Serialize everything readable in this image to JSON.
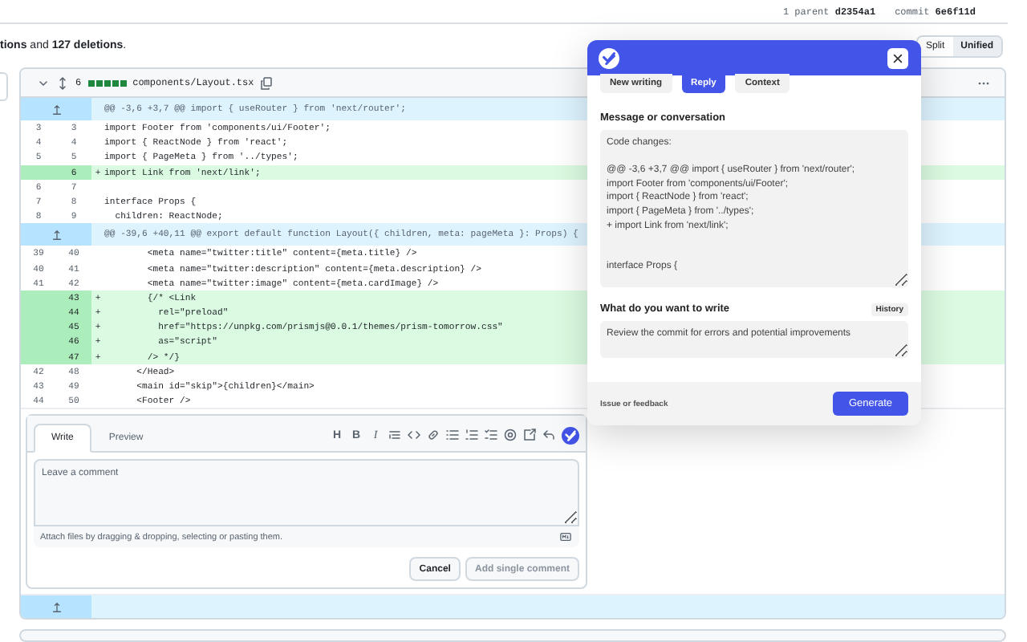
{
  "commit_info": {
    "parent": "1 parent **d2354a1**",
    "commit": "commit **6e6f11d**"
  },
  "summary": "**tions** and **127 deletions**.",
  "view_toggle": [
    {
      "label": "Split",
      "selected": false
    },
    {
      "label": "Unified",
      "selected": true
    }
  ],
  "file": {
    "changes": "6",
    "diffstat": [
      {
        "kind": "add"
      },
      {
        "kind": "add"
      },
      {
        "kind": "add"
      },
      {
        "kind": "add"
      },
      {
        "kind": "add"
      }
    ],
    "name": "components/Layout.tsx",
    "lines": [
      {
        "kind": "hunk",
        "code": "@@ -3,6 +3,7 @@ import { useRouter } from 'next/router';"
      },
      {
        "kind": "context",
        "old": "3",
        "new": "3",
        "code": "import Footer from 'components/ui/Footer';"
      },
      {
        "kind": "context",
        "old": "4",
        "new": "4",
        "code": "import { ReactNode } from 'react';"
      },
      {
        "kind": "context",
        "old": "5",
        "new": "5",
        "code": "import { PageMeta } from '../types';"
      },
      {
        "kind": "add",
        "new": "6",
        "sign": "+",
        "code": "import Link from 'next/link';"
      },
      {
        "kind": "context",
        "old": "6",
        "new": "7"
      },
      {
        "kind": "context",
        "old": "7",
        "new": "8",
        "code": "interface Props {"
      },
      {
        "kind": "context",
        "old": "8",
        "new": "9",
        "code": "  children: ReactNode;"
      },
      {
        "kind": "hunk",
        "code": "@@ -39,6 +40,11 @@ export default function Layout({ children, meta: pageMeta }: Props) {"
      },
      {
        "kind": "context",
        "old": "39",
        "new": "40",
        "code": "        <meta name=\"twitter:title\" content={meta.title} />"
      },
      {
        "kind": "context",
        "old": "40",
        "new": "41",
        "code": "        <meta name=\"twitter:description\" content={meta.description} />"
      },
      {
        "kind": "context",
        "old": "41",
        "new": "42",
        "code": "        <meta name=\"twitter:image\" content={meta.cardImage} />"
      },
      {
        "kind": "add",
        "new": "43",
        "sign": "+",
        "code": "        {/* <Link"
      },
      {
        "kind": "add",
        "new": "44",
        "sign": "+",
        "code": "          rel=\"preload\""
      },
      {
        "kind": "add",
        "new": "45",
        "sign": "+",
        "code": "          href=\"https://unpkg.com/prismjs@0.0.1/themes/prism-tomorrow.css\""
      },
      {
        "kind": "add",
        "new": "46",
        "sign": "+",
        "code": "          as=\"script\""
      },
      {
        "kind": "add",
        "new": "47",
        "sign": "+",
        "code": "        /> */}"
      },
      {
        "kind": "context",
        "old": "42",
        "new": "48",
        "code": "      </Head>"
      },
      {
        "kind": "context",
        "old": "43",
        "new": "49",
        "code": "      <main id=\"skip\">{children}</main>"
      },
      {
        "kind": "context",
        "old": "44",
        "new": "50",
        "code": "      <Footer />"
      },
      {
        "kind": "comment"
      },
      {
        "kind": "expander"
      }
    ]
  },
  "comment": {
    "tabs": [
      {
        "label": "Write",
        "selected": true
      },
      {
        "label": "Preview",
        "selected": false
      }
    ],
    "toolbar": [
      "H",
      "B",
      "I"
    ],
    "placeholder": "Leave a comment",
    "attach_hint": "Attach files by dragging & dropping, selecting or pasting them.",
    "buttons": [
      {
        "label": "Cancel",
        "disabled": false
      },
      {
        "label": "Add single comment",
        "disabled": true
      }
    ]
  },
  "assistant": {
    "tabs": [
      {
        "label": "New writing",
        "selected": false
      },
      {
        "label": "Reply",
        "selected": true
      },
      {
        "label": "Context",
        "selected": false
      }
    ],
    "message_label": "Message or conversation",
    "message": "Code changes:\n\n@@ -3,6 +3,7 @@ import { useRouter } from 'next/router';\nimport Footer from 'components/ui/Footer';\nimport { ReactNode } from 'react';\nimport { PageMeta } from '../types';\n+ import Link from 'next/link';\n\n\ninterface Props {",
    "prompt_label": "What do you want to write",
    "history": "History",
    "prompt": "Review the commit for errors and potential improvements",
    "feedback": "Issue or feedback",
    "generate": "Generate"
  }
}
